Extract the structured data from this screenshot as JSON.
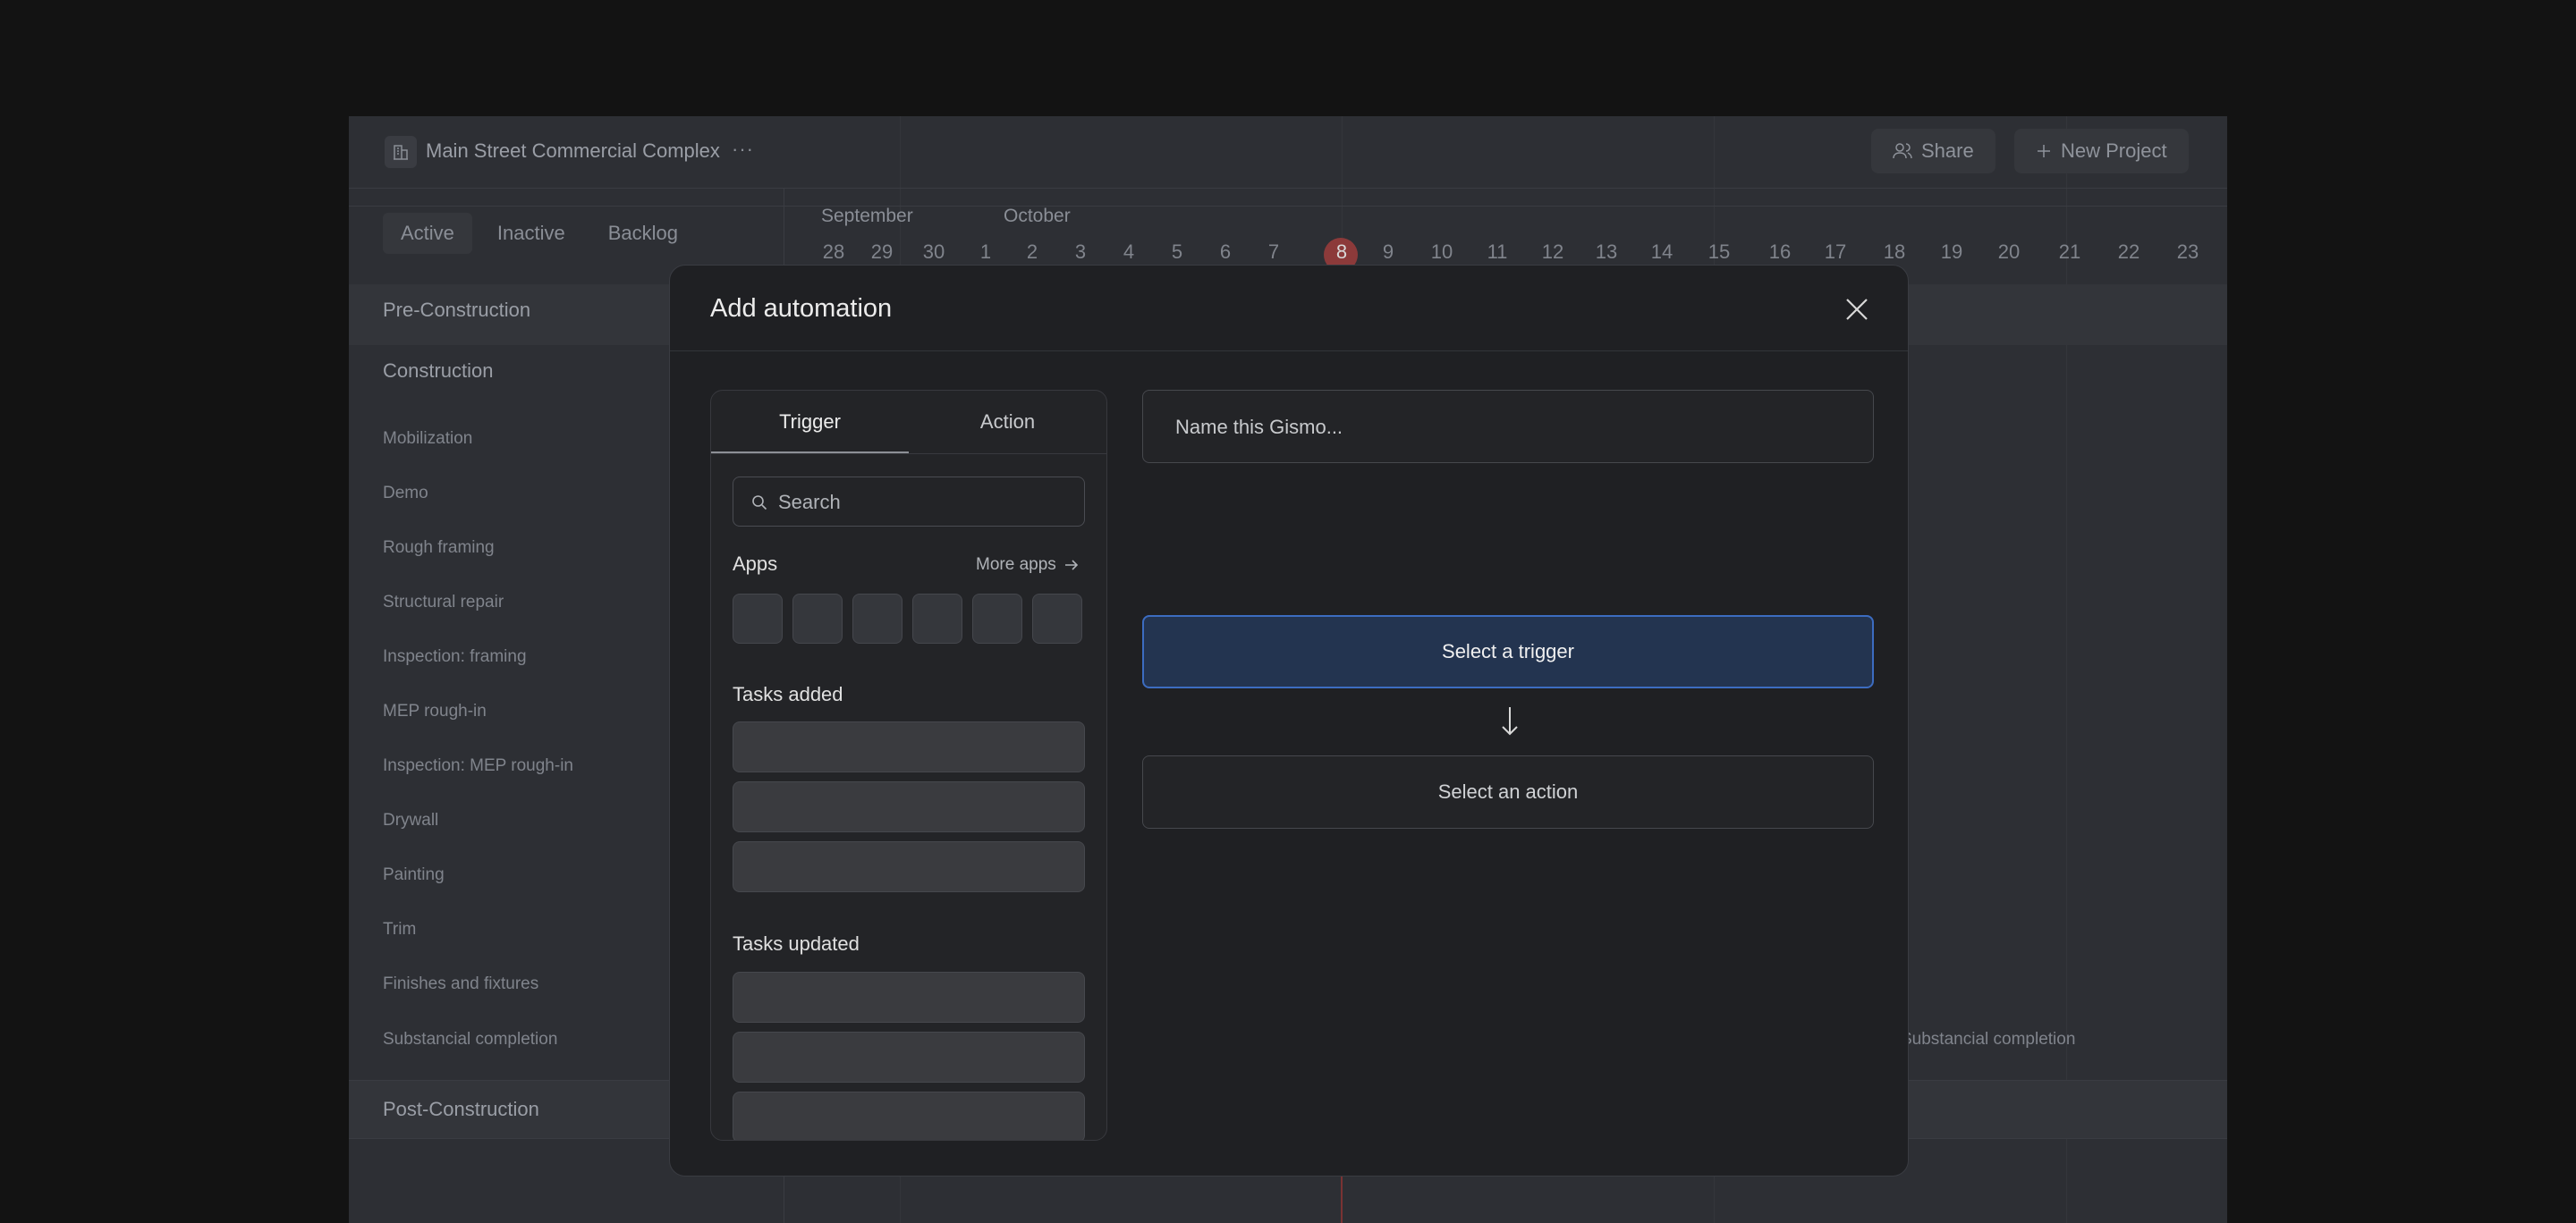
{
  "project": {
    "title": "Main Street Commercial Complex",
    "more": "···"
  },
  "header": {
    "share_label": "Share",
    "new_project_label": "New Project"
  },
  "filter_tabs": [
    "Active",
    "Inactive",
    "Backlog"
  ],
  "groups": {
    "pre": "Pre-Construction",
    "construction": "Construction",
    "post": "Post-Construction"
  },
  "tasks": [
    "Mobilization",
    "Demo",
    "Rough framing",
    "Structural repair",
    "Inspection: framing",
    "MEP rough-in",
    "Inspection: MEP rough-in",
    "Drywall",
    "Painting",
    "Trim",
    "Finishes and fixtures",
    "Substancial completion"
  ],
  "timeline": {
    "months": [
      "September",
      "October"
    ],
    "days": [
      "28",
      "29",
      "30",
      "1",
      "2",
      "3",
      "4",
      "5",
      "6",
      "7",
      "8",
      "9",
      "10",
      "11",
      "12",
      "13",
      "14",
      "15",
      "16",
      "17",
      "18",
      "19",
      "20",
      "21",
      "22",
      "23"
    ],
    "today": "8",
    "bar_label": "Substancial completion",
    "today_color": "#8c3a3a"
  },
  "modal": {
    "title": "Add automation",
    "tabs": {
      "trigger": "Trigger",
      "action": "Action"
    },
    "search_placeholder": "Search",
    "apps_title": "Apps",
    "more_apps": "More apps",
    "tasks_added_title": "Tasks added",
    "tasks_updated_title": "Tasks updated",
    "name_placeholder": "Name this Gismo...",
    "select_trigger": "Select a trigger",
    "select_action": "Select an action",
    "accent": "#3c6cc0"
  }
}
